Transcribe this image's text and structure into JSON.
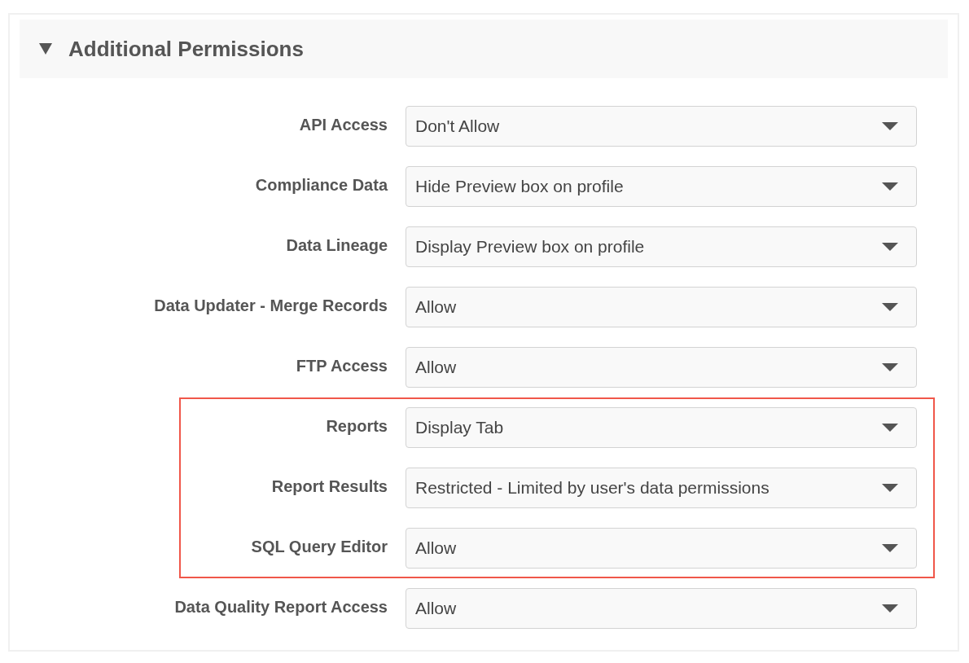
{
  "section": {
    "title": "Additional Permissions",
    "expanded": true
  },
  "groups": [
    {
      "highlighted": false,
      "rows": [
        {
          "label": "API Access",
          "value": "Don't Allow"
        },
        {
          "label": "Compliance Data",
          "value": "Hide Preview box on profile"
        },
        {
          "label": "Data Lineage",
          "value": "Display Preview box on profile"
        },
        {
          "label": "Data Updater - Merge Records",
          "value": "Allow"
        },
        {
          "label": "FTP Access",
          "value": "Allow"
        }
      ]
    },
    {
      "highlighted": true,
      "rows": [
        {
          "label": "Reports",
          "value": "Display Tab"
        },
        {
          "label": "Report Results",
          "value": "Restricted - Limited by user's data permissions"
        },
        {
          "label": "SQL Query Editor",
          "value": "Allow"
        }
      ]
    },
    {
      "highlighted": false,
      "rows": [
        {
          "label": "Data Quality Report Access",
          "value": "Allow"
        }
      ]
    }
  ]
}
